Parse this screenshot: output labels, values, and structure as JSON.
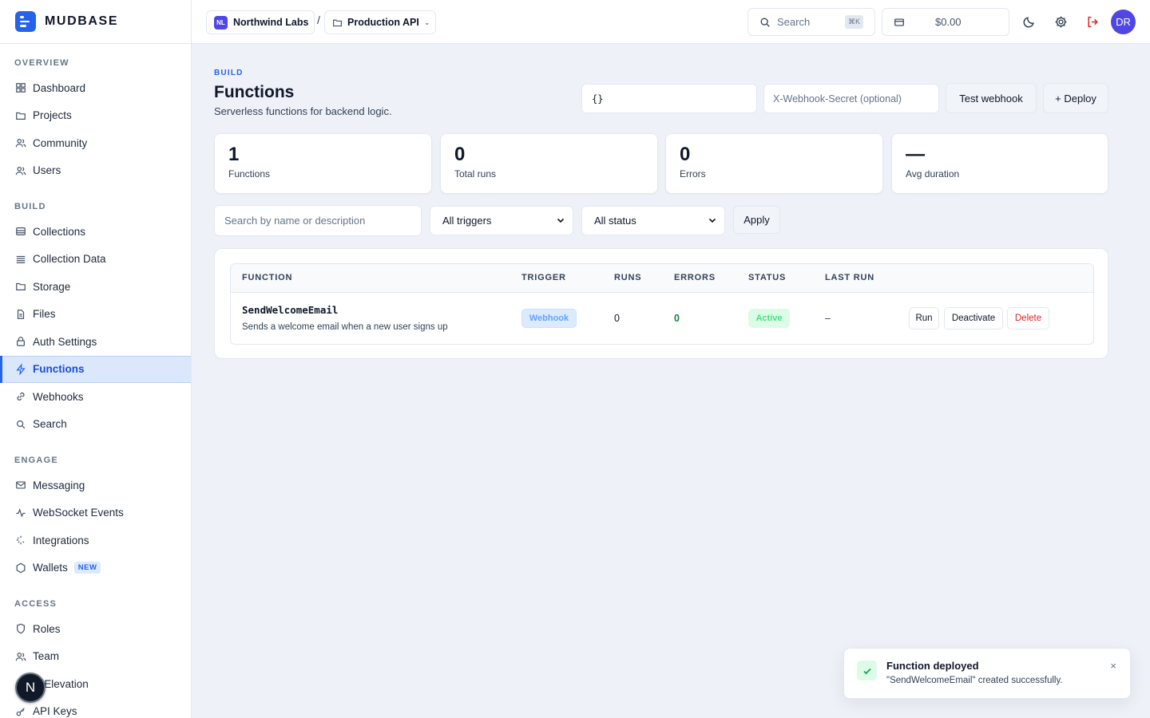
{
  "brand": {
    "name": "MUDBASE"
  },
  "sidebar": {
    "sections": [
      {
        "heading": "OVERVIEW",
        "items": [
          {
            "label": "Dashboard",
            "icon": "grid-icon"
          },
          {
            "label": "Projects",
            "icon": "folder-icon"
          },
          {
            "label": "Community",
            "icon": "users-icon"
          },
          {
            "label": "Users",
            "icon": "users-icon"
          }
        ]
      },
      {
        "heading": "BUILD",
        "items": [
          {
            "label": "Collections",
            "icon": "database-icon"
          },
          {
            "label": "Collection Data",
            "icon": "list-icon"
          },
          {
            "label": "Storage",
            "icon": "folder-icon"
          },
          {
            "label": "Files",
            "icon": "file-icon"
          },
          {
            "label": "Auth Settings",
            "icon": "lock-icon"
          },
          {
            "label": "Functions",
            "icon": "bolt-icon",
            "active": true
          },
          {
            "label": "Webhooks",
            "icon": "link-icon"
          },
          {
            "label": "Search",
            "icon": "search-icon"
          }
        ]
      },
      {
        "heading": "ENGAGE",
        "items": [
          {
            "label": "Messaging",
            "icon": "mail-icon"
          },
          {
            "label": "WebSocket Events",
            "icon": "activity-icon"
          },
          {
            "label": "Integrations",
            "icon": "sparkle-icon"
          },
          {
            "label": "Wallets",
            "icon": "hexagon-icon",
            "badge": "NEW"
          }
        ]
      },
      {
        "heading": "ACCESS",
        "items": [
          {
            "label": "Roles",
            "icon": "shield-icon"
          },
          {
            "label": "Team",
            "icon": "users-icon"
          },
          {
            "label": "Role Elevation",
            "icon": "arrow-up-icon",
            "visible_label": "le Elevation"
          },
          {
            "label": "API Keys",
            "icon": "key-icon"
          }
        ]
      }
    ],
    "floating_badge": "N"
  },
  "topbar": {
    "org": {
      "initials": "NL",
      "name": "Northwind Labs"
    },
    "separator": "/",
    "project": {
      "name": "Production API"
    },
    "search": {
      "label": "Search",
      "shortcut": "⌘K"
    },
    "balance": "$0.00",
    "user_initials": "DR"
  },
  "page": {
    "eyebrow": "BUILD",
    "title": "Functions",
    "subtitle": "Serverless functions for backend logic.",
    "payload_value": "{}",
    "secret_placeholder": "X-Webhook-Secret (optional)",
    "test_button": "Test webhook",
    "deploy_button": "+ Deploy"
  },
  "stats": [
    {
      "value": "1",
      "label": "Functions"
    },
    {
      "value": "0",
      "label": "Total runs"
    },
    {
      "value": "0",
      "label": "Errors"
    },
    {
      "value": "—",
      "label": "Avg duration"
    }
  ],
  "filters": {
    "search_placeholder": "Search by name or description",
    "trigger_selected": "All triggers",
    "status_selected": "All status",
    "apply": "Apply"
  },
  "table": {
    "headers": [
      "FUNCTION",
      "TRIGGER",
      "RUNS",
      "ERRORS",
      "STATUS",
      "LAST RUN"
    ],
    "rows": [
      {
        "name": "SendWelcomeEmail",
        "description": "Sends a welcome email when a new user signs up",
        "trigger": "Webhook",
        "runs": "0",
        "errors": "0",
        "status": "Active",
        "last_run": "–",
        "actions": [
          "Run",
          "Deactivate",
          "Delete"
        ]
      }
    ]
  },
  "toast": {
    "title": "Function deployed",
    "message": "\"SendWelcomeEmail\" created successfully.",
    "close": "×"
  },
  "colors": {
    "accent": "#2563eb",
    "danger": "#dc2626",
    "success": "#16a34a"
  }
}
